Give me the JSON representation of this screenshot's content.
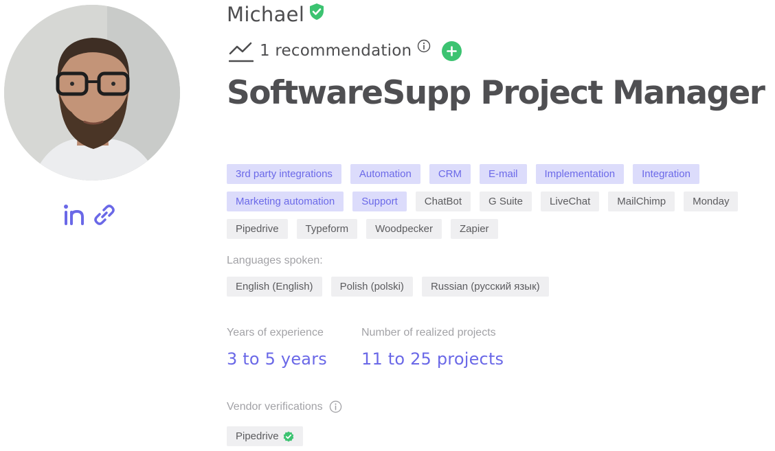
{
  "profile": {
    "name": "Michael",
    "recommendations": "1 recommendation",
    "title": "SoftwareSupp Project Manager",
    "avatar_alt": "Profile photo"
  },
  "social": {
    "linkedin_icon": "linkedin-icon",
    "website_icon": "link-icon"
  },
  "tags": [
    {
      "label": "3rd party integrations",
      "highlight": true
    },
    {
      "label": "Automation",
      "highlight": true
    },
    {
      "label": "CRM",
      "highlight": true
    },
    {
      "label": "E-mail",
      "highlight": true
    },
    {
      "label": "Implementation",
      "highlight": true
    },
    {
      "label": "Integration",
      "highlight": true
    },
    {
      "label": "Marketing automation",
      "highlight": true
    },
    {
      "label": "Support",
      "highlight": true
    },
    {
      "label": "ChatBot",
      "highlight": false
    },
    {
      "label": "G Suite",
      "highlight": false
    },
    {
      "label": "LiveChat",
      "highlight": false
    },
    {
      "label": "MailChimp",
      "highlight": false
    },
    {
      "label": "Monday",
      "highlight": false
    },
    {
      "label": "Pipedrive",
      "highlight": false
    },
    {
      "label": "Typeform",
      "highlight": false
    },
    {
      "label": "Woodpecker",
      "highlight": false
    },
    {
      "label": "Zapier",
      "highlight": false
    }
  ],
  "languages": {
    "label": "Languages spoken:",
    "items": [
      "English (English)",
      "Polish (polski)",
      "Russian (русский язык)"
    ]
  },
  "experience": {
    "label": "Years of experience",
    "value": "3 to 5 years"
  },
  "projects": {
    "label": "Number of realized projects",
    "value": "11 to 25 projects"
  },
  "vendor": {
    "label": "Vendor verifications",
    "items": [
      "Pipedrive"
    ]
  },
  "colors": {
    "accent": "#6a68e7",
    "highlight_tag_bg": "#dcdcfb",
    "plain_tag_bg": "#efeff1",
    "verified_green": "#3cc371",
    "heading_text": "#4f4f52",
    "muted_text": "#a2a2a6"
  }
}
